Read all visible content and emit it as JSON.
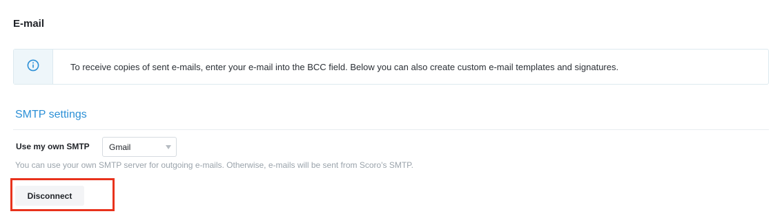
{
  "page": {
    "title": "E-mail"
  },
  "info": {
    "icon": "info-icon",
    "text": "To receive copies of sent e-mails, enter your e-mail into the BCC field. Below you can also create custom e-mail templates and signatures."
  },
  "smtp": {
    "section_title": "SMTP settings",
    "field_label": "Use my own SMTP",
    "selected_option": "Gmail",
    "help_text": "You can use your own SMTP server for outgoing e-mails. Otherwise, e-mails will be sent from Scoro's SMTP.",
    "disconnect_label": "Disconnect"
  },
  "colors": {
    "accent": "#2b8fd6",
    "highlight": "#e8321c",
    "info_bg": "#eef6fa"
  }
}
